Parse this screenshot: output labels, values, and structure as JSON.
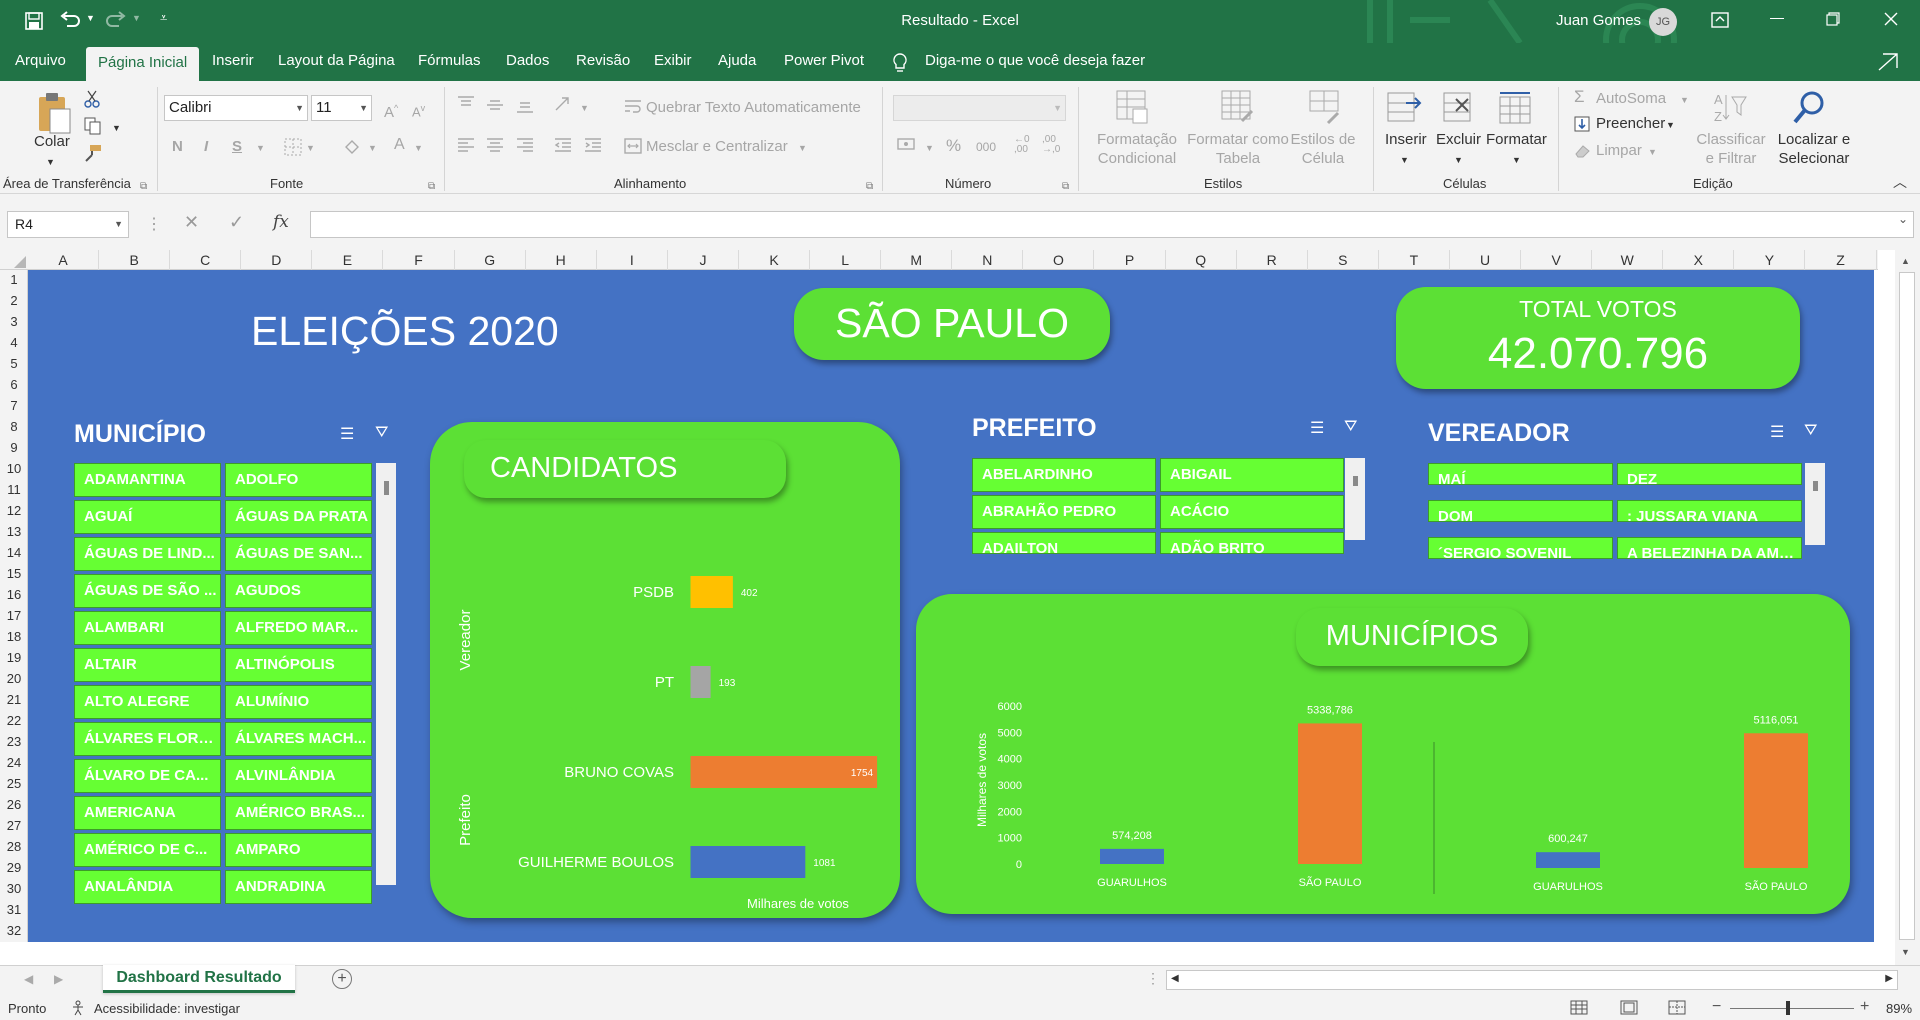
{
  "window": {
    "title": "Resultado  -  Excel",
    "user": "Juan Gomes",
    "user_initials": "JG"
  },
  "ribbon_tabs": [
    "Arquivo",
    "Página Inicial",
    "Inserir",
    "Layout da Página",
    "Fórmulas",
    "Dados",
    "Revisão",
    "Exibir",
    "Ajuda",
    "Power Pivot"
  ],
  "tell_me": "Diga-me o que você deseja fazer",
  "ribbon": {
    "clipboard": {
      "paste": "Colar",
      "label": "Área de Transferência"
    },
    "font": {
      "name": "Calibri",
      "size": "11",
      "bold": "N",
      "italic": "I",
      "underline": "S",
      "label": "Fonte"
    },
    "alignment": {
      "wrap": "Quebrar Texto Automaticamente",
      "merge": "Mesclar e Centralizar",
      "label": "Alinhamento"
    },
    "number": {
      "percent": "%",
      "thousands": "000",
      "label": "Número"
    },
    "styles": {
      "conditional": "Formatação\nCondicional",
      "table": "Formatar como\nTabela",
      "cell": "Estilos de\nCélula",
      "label": "Estilos"
    },
    "cells": {
      "insert": "Inserir",
      "delete": "Excluir",
      "format": "Formatar",
      "label": "Células"
    },
    "editing": {
      "autosum": "AutoSoma",
      "fill": "Preencher",
      "clear": "Limpar",
      "sort": "Classificar\ne Filtrar",
      "find": "Localizar e\nSelecionar",
      "label": "Edição"
    }
  },
  "formula_bar": {
    "name_box": "R4",
    "fx": "fx",
    "value": ""
  },
  "columns": [
    "A",
    "B",
    "C",
    "D",
    "E",
    "F",
    "G",
    "H",
    "I",
    "J",
    "K",
    "L",
    "M",
    "N",
    "O",
    "P",
    "Q",
    "R",
    "S",
    "T",
    "U",
    "V",
    "W",
    "X",
    "Y",
    "Z"
  ],
  "rows": [
    "1",
    "2",
    "3",
    "4",
    "5",
    "6",
    "7",
    "8",
    "9",
    "10",
    "11",
    "12",
    "13",
    "14",
    "15",
    "16",
    "17",
    "18",
    "19",
    "20",
    "21",
    "22",
    "23",
    "24",
    "25",
    "26",
    "27",
    "28",
    "29",
    "30",
    "31",
    "32"
  ],
  "dashboard": {
    "title": "ELEIÇÕES 2020",
    "city": "SÃO PAULO",
    "total_label": "TOTAL VOTOS",
    "total_value": "42.070.796",
    "municipio": {
      "header": "MUNICÍPIO",
      "items": [
        "ADAMANTINA",
        "ADOLFO",
        "AGUAÍ",
        "ÁGUAS DA PRATA",
        "ÁGUAS DE LIND...",
        "ÁGUAS DE SAN...",
        "ÁGUAS DE SÃO ...",
        "AGUDOS",
        "ALAMBARI",
        "ALFREDO MAR...",
        "ALTAIR",
        "ALTINÓPOLIS",
        "ALTO ALEGRE",
        "ALUMÍNIO",
        "ÁLVARES FLORE...",
        "ÁLVARES MACH...",
        "ÁLVARO DE CA...",
        "ALVINLÂNDIA",
        "AMERICANA",
        "AMÉRICO BRAS...",
        "AMÉRICO DE C...",
        "AMPARO",
        "ANALÂNDIA",
        "ANDRADINA"
      ]
    },
    "prefeito": {
      "header": "PREFEITO",
      "items": [
        "ABELARDINHO",
        "ABIGAIL",
        "ABRAHÃO PEDRO",
        "ACÁCIO",
        "ADAILTON",
        "ADÃO BRITO"
      ]
    },
    "vereador": {
      "header": "VEREADOR",
      "items": [
        "MAÍ",
        "DEZ",
        "DOM",
        ": JUSSARA VIANA",
        "´SERGIO SOVENIL",
        "A BELEZINHA DA AMB..."
      ]
    },
    "candidatos_title": "CANDIDATOS",
    "municipios_title": "MUNICÍPIOS"
  },
  "chart_data": [
    {
      "type": "bar",
      "orientation": "horizontal",
      "title": "CANDIDATOS",
      "xlabel": "Milhares de votos",
      "groups": [
        "Vereador",
        "Prefeito"
      ],
      "categories": [
        "PSDB",
        "PT",
        "BRUNO COVAS",
        "GUILHERME BOULOS"
      ],
      "category_group": [
        "Vereador",
        "Vereador",
        "Prefeito",
        "Prefeito"
      ],
      "values": [
        402,
        193,
        1754,
        1081
      ],
      "colors": [
        "#ffc000",
        "#a5a5a5",
        "#ed7d31",
        "#4472c4"
      ],
      "xlim": [
        0,
        1800
      ]
    },
    {
      "type": "bar",
      "title": "MUNICÍPIOS",
      "ylabel": "Milhares de votos",
      "ylim": [
        0,
        6000
      ],
      "yticks": [
        0,
        1000,
        2000,
        3000,
        4000,
        5000,
        6000
      ],
      "panels": [
        {
          "categories": [
            "GUARULHOS",
            "SÃO PAULO"
          ],
          "values": [
            574.208,
            5338.786
          ],
          "labels": [
            "574,208",
            "5338,786"
          ],
          "colors": [
            "#4472c4",
            "#ed7d31"
          ]
        },
        {
          "categories": [
            "GUARULHOS",
            "SÃO PAULO"
          ],
          "values": [
            600.247,
            5116.051
          ],
          "labels": [
            "600,247",
            "5116,051"
          ],
          "colors": [
            "#4472c4",
            "#ed7d31"
          ]
        }
      ]
    }
  ],
  "sheet_tab": "Dashboard Resultado",
  "status": {
    "ready": "Pronto",
    "accessibility": "Acessibilidade: investigar",
    "zoom": "89%"
  }
}
